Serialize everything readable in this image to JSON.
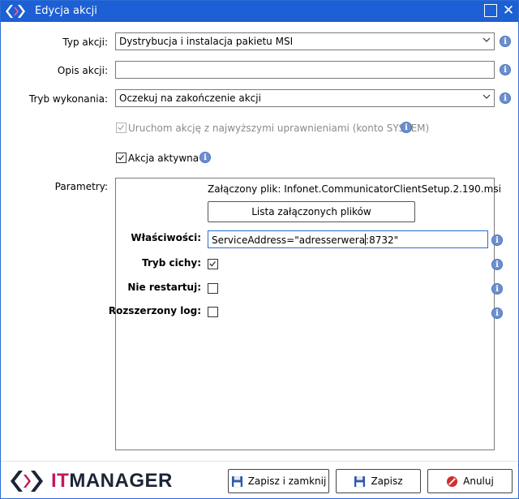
{
  "window": {
    "title": "Edycja akcji"
  },
  "form": {
    "action_type_label": "Typ akcji:",
    "action_type_value": "Dystrybucja i instalacja pakietu MSI",
    "description_label": "Opis akcji:",
    "description_value": "",
    "mode_label": "Tryb wykonania:",
    "mode_value": "Oczekuj na zakończenie akcji",
    "run_elevated_label": "Uruchom akcję z najwyższymi uprawnieniami (konto SYSTEM)",
    "active_label": "Akcja aktywna",
    "params_label": "Parametry:"
  },
  "params": {
    "attached_file": "Załączony plik: Infonet.CommunicatorClientSetup.2.190.msi",
    "list_files_button": "Lista załączonych plików",
    "properties_label": "Właściwości:",
    "properties_value_before_caret": "ServiceAddress=\"adresserwera",
    "properties_value_after_caret": ":8732\"",
    "quiet_label": "Tryb cichy:",
    "no_restart_label": "Nie restartuj:",
    "extended_log_label": "Rozszerzony log:"
  },
  "footer": {
    "brand_text": "ITMANAGER",
    "save_close_button": "Zapisz i zamknij",
    "save_button": "Zapisz",
    "cancel_button": "Anuluj"
  },
  "colors": {
    "titlebar": "#1d5fd4",
    "info_icon": "#6d8fd0",
    "brand_dark": "#1c2536",
    "brand_pink": "#c2185b",
    "cancel_red": "#d32f2f"
  }
}
